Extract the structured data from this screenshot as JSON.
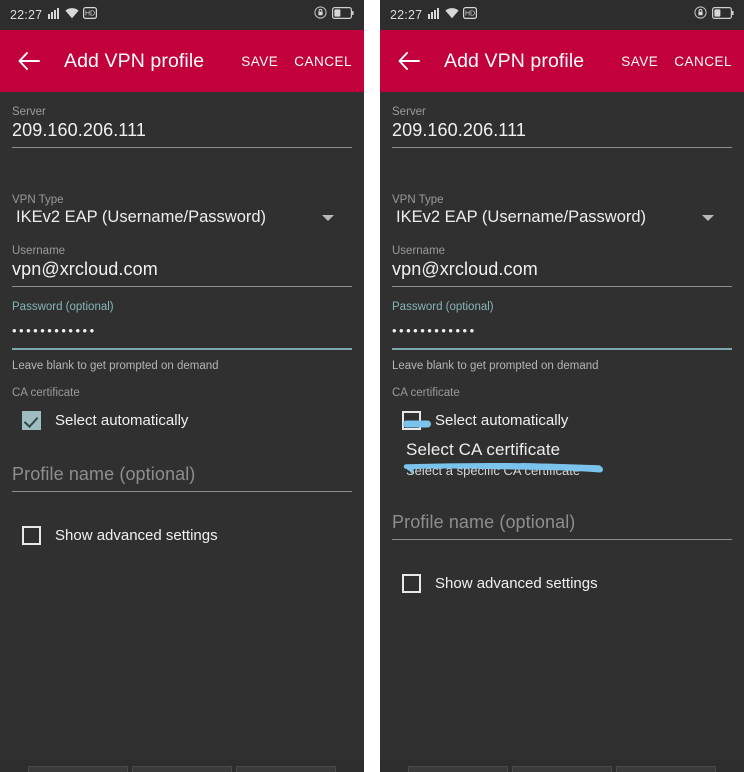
{
  "status_bar": {
    "clock": "22:27",
    "icons_left": [
      "signal-icon",
      "wifi-icon",
      "hd-icon"
    ],
    "icons_right": [
      "rotation-lock-icon",
      "battery-icon"
    ]
  },
  "app_bar": {
    "back_icon": "back-arrow-icon",
    "title": "Add VPN profile",
    "save_label": "SAVE",
    "cancel_label": "CANCEL",
    "background_color": "#c2003b"
  },
  "form": {
    "server": {
      "label": "Server",
      "value": "209.160.206.111"
    },
    "vpn_type": {
      "label": "VPN Type",
      "value": "IKEv2 EAP (Username/Password)",
      "caret_icon": "chevron-down-icon"
    },
    "username": {
      "label": "Username",
      "value": "vpn@xrcloud.com"
    },
    "password": {
      "label": "Password (optional)",
      "value": "••••••••••••",
      "helper": "Leave blank to get prompted on demand",
      "accent_color": "#86b5b9"
    },
    "ca_certificate": {
      "label": "CA certificate",
      "select_automatically_label": "Select automatically",
      "select_automatically_checked_left": true,
      "select_automatically_checked_right": false,
      "ca_item_title": "Select CA certificate",
      "ca_item_subtitle": "Select a specific CA certificate"
    },
    "profile_name": {
      "placeholder": "Profile name (optional)",
      "value": ""
    },
    "advanced": {
      "label": "Show advanced settings",
      "checked": false
    }
  },
  "annotations": {
    "ink_color": "#79c3ec",
    "marks": [
      {
        "name": "checkbox-highlight",
        "target": "select-automatically-checkbox"
      },
      {
        "name": "ca-item-underline",
        "target": "select-ca-certificate-item"
      }
    ]
  },
  "nav_bar": {
    "keys": [
      "back-key",
      "home-key",
      "recents-key"
    ]
  }
}
